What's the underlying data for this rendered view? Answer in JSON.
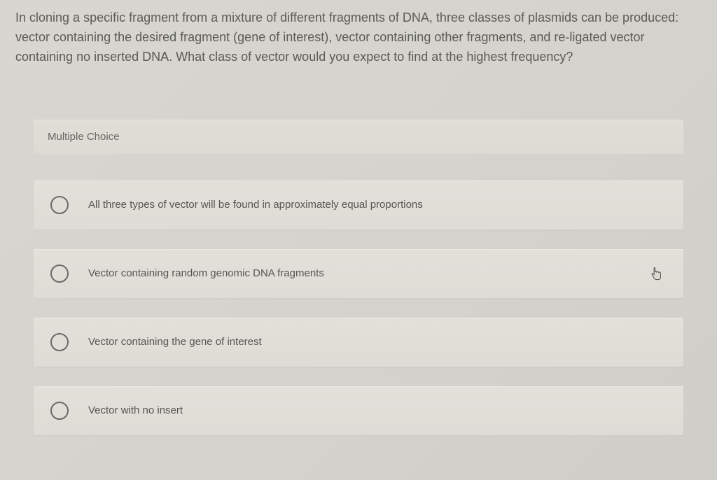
{
  "question": {
    "text": "In cloning a specific fragment from a mixture of different fragments of DNA, three classes of plasmids can be produced: vector containing the desired fragment (gene of interest), vector containing other fragments, and re-ligated vector containing no inserted DNA. What class of vector would you expect to find at the highest frequency?"
  },
  "section": {
    "header": "Multiple Choice"
  },
  "options": [
    {
      "label": "All three types of vector will be found in approximately equal proportions"
    },
    {
      "label": "Vector containing random genomic DNA fragments"
    },
    {
      "label": "Vector containing the gene of interest"
    },
    {
      "label": "Vector with no insert"
    }
  ]
}
